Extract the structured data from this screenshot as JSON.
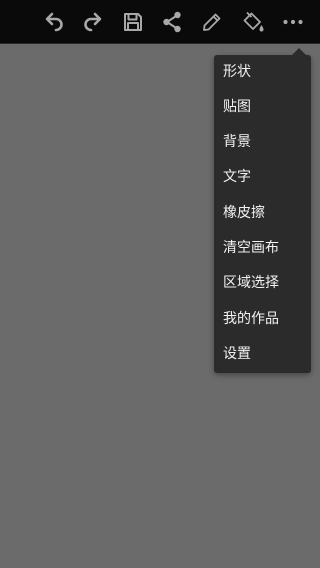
{
  "toolbar": {
    "icons": [
      {
        "name": "undo-icon"
      },
      {
        "name": "redo-icon"
      },
      {
        "name": "save-icon"
      },
      {
        "name": "share-icon"
      },
      {
        "name": "pencil-icon"
      },
      {
        "name": "paint-bucket-icon"
      },
      {
        "name": "more-icon"
      }
    ],
    "icon_color": "#a8a8a8"
  },
  "canvas": {
    "background": "#6b6b6b"
  },
  "menu": {
    "items": [
      {
        "label": "形状"
      },
      {
        "label": "贴图"
      },
      {
        "label": "背景"
      },
      {
        "label": "文字"
      },
      {
        "label": "橡皮擦"
      },
      {
        "label": "清空画布"
      },
      {
        "label": "区域选择"
      },
      {
        "label": "我的作品"
      },
      {
        "label": "设置"
      }
    ]
  }
}
